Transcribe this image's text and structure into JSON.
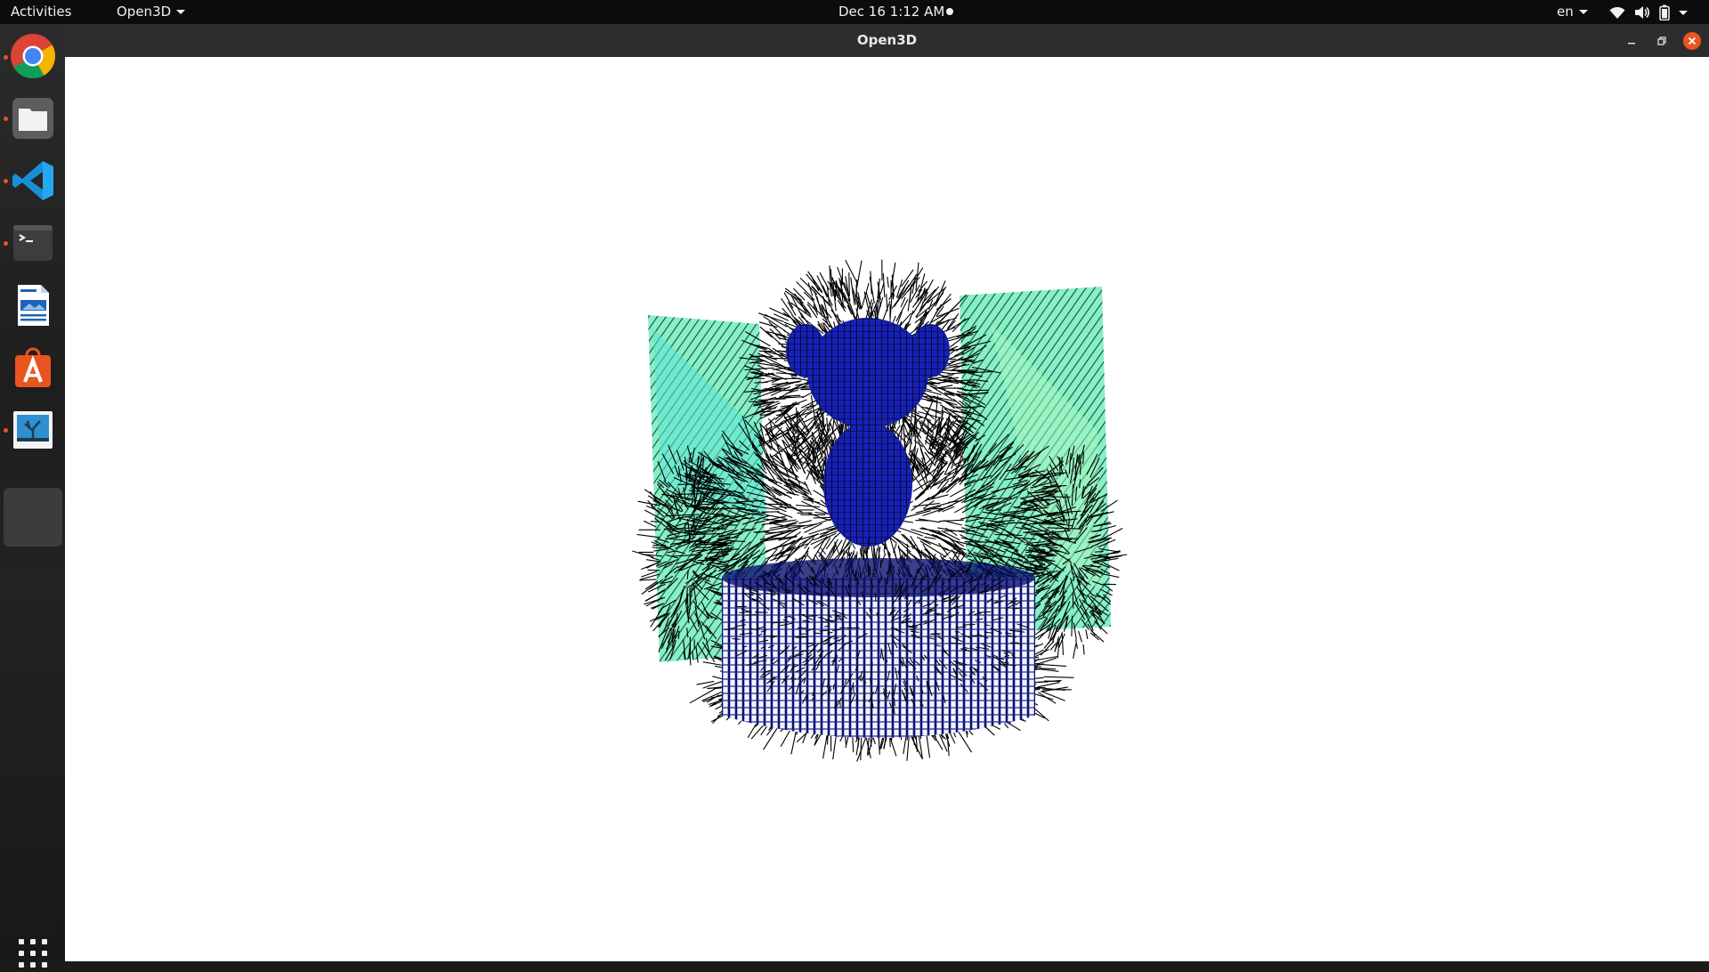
{
  "topbar": {
    "activities": "Activities",
    "app_menu": "Open3D",
    "clock": "Dec 16  1:12 AM",
    "language": "en",
    "tray_icons": [
      "wifi-icon",
      "volume-icon",
      "battery-icon",
      "system-menu-caret-icon"
    ]
  },
  "dock": {
    "apps": [
      {
        "name": "Google Chrome",
        "icon": "chrome-icon",
        "running": true
      },
      {
        "name": "Files",
        "icon": "files-icon",
        "running": true
      },
      {
        "name": "Visual Studio Code",
        "icon": "vscode-icon",
        "running": true
      },
      {
        "name": "Terminal",
        "icon": "terminal-icon",
        "running": true
      },
      {
        "name": "LibreOffice Writer",
        "icon": "writer-icon",
        "running": false
      },
      {
        "name": "Ubuntu Software",
        "icon": "software-icon",
        "running": false
      },
      {
        "name": "Image Viewer",
        "icon": "image-viewer-icon",
        "running": true
      },
      {
        "name": "Open3D",
        "icon": "open3d-window-icon",
        "running": true
      }
    ],
    "show_apps_icon": "grid-icon"
  },
  "window": {
    "title": "Open3D",
    "controls": [
      "minimize-icon",
      "maximize-icon",
      "close-icon"
    ],
    "viewport": {
      "background": "#ffffff",
      "content": "point cloud with normal vectors",
      "colors": {
        "figure": "#1a23c8",
        "backdrop": "#7ff0c0",
        "normals": "#000000"
      }
    }
  },
  "colors": {
    "accent": "#e95420",
    "topbar": "#0c0c0c",
    "titlebar": "#2d2d2d"
  }
}
